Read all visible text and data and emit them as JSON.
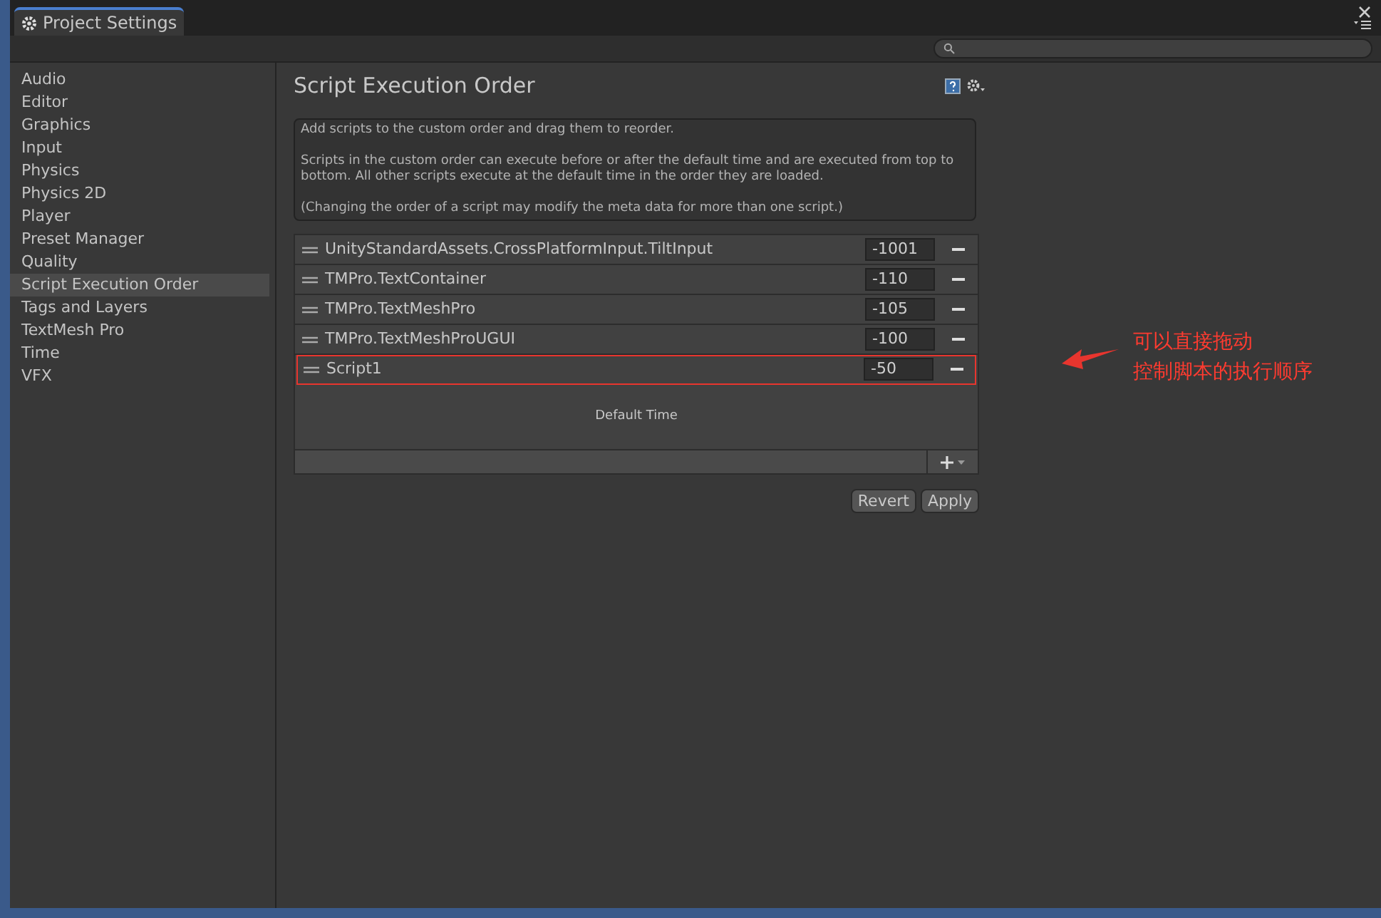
{
  "window": {
    "tab": "Project Settings"
  },
  "sidebar": {
    "items": [
      {
        "label": "Audio",
        "selected": false
      },
      {
        "label": "Editor",
        "selected": false
      },
      {
        "label": "Graphics",
        "selected": false
      },
      {
        "label": "Input",
        "selected": false
      },
      {
        "label": "Physics",
        "selected": false
      },
      {
        "label": "Physics 2D",
        "selected": false
      },
      {
        "label": "Player",
        "selected": false
      },
      {
        "label": "Preset Manager",
        "selected": false
      },
      {
        "label": "Quality",
        "selected": false
      },
      {
        "label": "Script Execution Order",
        "selected": true
      },
      {
        "label": "Tags and Layers",
        "selected": false
      },
      {
        "label": "TextMesh Pro",
        "selected": false
      },
      {
        "label": "Time",
        "selected": false
      },
      {
        "label": "VFX",
        "selected": false
      }
    ]
  },
  "panel": {
    "title": "Script Execution Order",
    "help": [
      "Add scripts to the custom order and drag them to reorder.",
      "Scripts in the custom order can execute before or after the default time and are executed from top to bottom. All other scripts execute at the default time in the order they are loaded.",
      "(Changing the order of a script may modify the meta data for more than one script.)"
    ],
    "scripts": [
      {
        "name": "UnityStandardAssets.CrossPlatformInput.TiltInput",
        "order": "-1001",
        "highlighted": false
      },
      {
        "name": "TMPro.TextContainer",
        "order": "-110",
        "highlighted": false
      },
      {
        "name": "TMPro.TextMeshPro",
        "order": "-105",
        "highlighted": false
      },
      {
        "name": "TMPro.TextMeshProUGUI",
        "order": "-100",
        "highlighted": false
      },
      {
        "name": "Script1",
        "order": "-50",
        "highlighted": true
      }
    ],
    "default_time": "Default Time",
    "buttons": [
      "Revert",
      "Apply"
    ]
  },
  "annotation": [
    "可以直接拖动",
    "控制脚本的执行顺序"
  ]
}
